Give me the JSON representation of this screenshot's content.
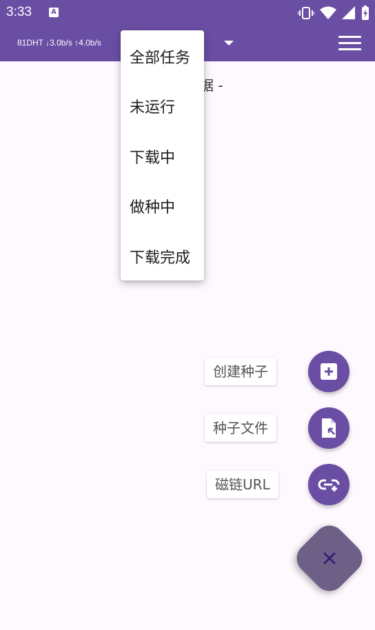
{
  "status_bar": {
    "time": "3:33",
    "notification_icon_letter": "A",
    "icons": [
      "vibrate-icon",
      "wifi-icon",
      "signal-icon",
      "battery-charging-icon"
    ]
  },
  "app_bar": {
    "speed_text": "81DHT ↓3.0b/s ↑4.0b/s",
    "filter_dropdown_icon": "dropdown-arrow-icon",
    "menu_icon": "hamburger-menu-icon"
  },
  "content": {
    "empty_text": "据 -"
  },
  "filter_menu": {
    "items": [
      "全部任务",
      "未运行",
      "下载中",
      "做种中",
      "下载完成"
    ]
  },
  "fab_actions": [
    {
      "label": "创建种子",
      "icon": "add-box-icon"
    },
    {
      "label": "种子文件",
      "icon": "file-open-icon"
    },
    {
      "label": "磁链URL",
      "icon": "add-link-icon"
    }
  ],
  "fab_main": {
    "icon": "close-icon"
  },
  "colors": {
    "primary": "#6a4ea3",
    "fab_main": "#6d5f85",
    "close_icon": "#3a1d78",
    "background": "#fdf9ff"
  }
}
